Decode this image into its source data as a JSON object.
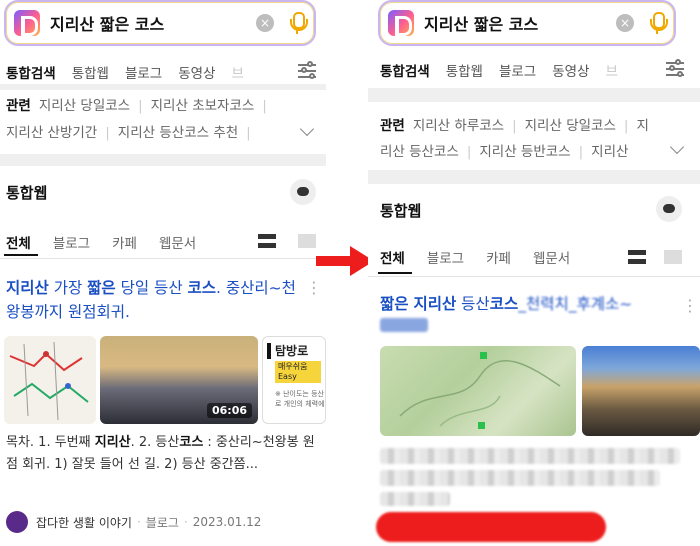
{
  "query": "지리산 짧은 코스",
  "clear_glyph": "×",
  "left": {
    "tabs": [
      "통합검색",
      "통합웹",
      "블로그",
      "동영상",
      "브"
    ],
    "related_label": "관련",
    "related_row1": [
      "지리산 당일코스",
      "지리산 초보자코스"
    ],
    "related_row2": [
      "지리산 산방기간",
      "지리산 등산코스 추천"
    ],
    "section_title": "통합웹",
    "subtabs": [
      "전체",
      "블로그",
      "카페",
      "웹문서"
    ],
    "result_title_parts": [
      "지리산",
      " 가장 ",
      "짧은",
      " 당일 등산 ",
      "코스",
      ". 중산리~천왕봉까지 원점회귀."
    ],
    "video_duration": "06:06",
    "card3_title": "탐방로",
    "card3_tag": "매우쉬움",
    "card3_tag2": "Easy",
    "card3_note": "※ 난이도는 등산로 개인의 체력에",
    "snippet_parts": [
      "목차. 1. 두번째 ",
      "지리산",
      ". 2. 등산",
      "코스",
      " : 중산리~천왕봉 원점 회귀. 1) 잘못 들어 선 길. 2) 등산 중간쯤..."
    ],
    "source_name": "잡다한 생활 이야기",
    "source_type": "블로그",
    "source_date": "2023.01.12"
  },
  "right": {
    "tabs": [
      "통합검색",
      "통합웹",
      "블로그",
      "동영상",
      "브"
    ],
    "related_label": "관련",
    "related_row1": [
      "지리산 하루코스",
      "지리산 당일코스",
      "지"
    ],
    "related_row2": [
      "리산 등산코스",
      "지리산 등반코스",
      "지리산"
    ],
    "section_title": "통합웹",
    "subtabs": [
      "전체",
      "블로그",
      "카페",
      "웹문서"
    ],
    "result_title_parts": [
      "짧은",
      " ",
      "지리산",
      " 등산",
      "코스",
      "_천력치_후계소~"
    ]
  },
  "colors": {
    "accent_blue": "#1a4fc4",
    "arrow_red": "#ee1d1d",
    "mic_yellow": "#f0a800"
  }
}
